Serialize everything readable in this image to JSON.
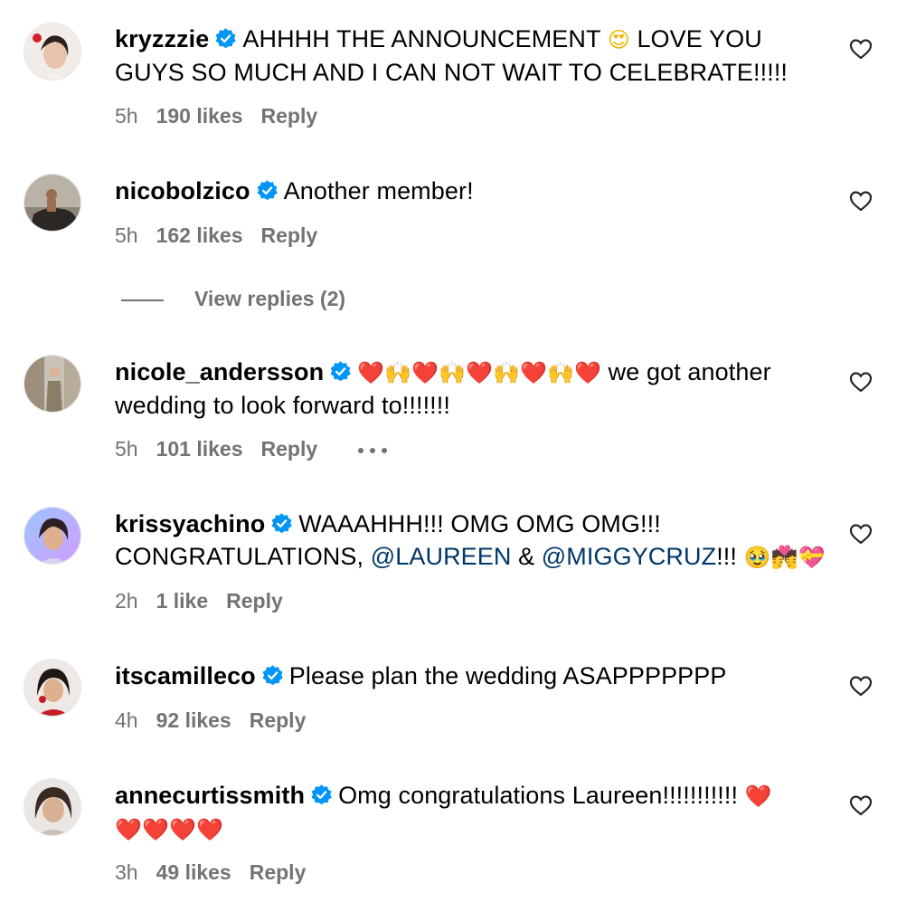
{
  "colors": {
    "text": "#000000",
    "secondary": "#737373",
    "verified_blue": "#0095f6",
    "mention": "#00376b",
    "heart_red": "#e0192c"
  },
  "icons": {
    "verified": "verified-badge-icon",
    "like": "heart-outline-icon",
    "more": "more-dots-icon"
  },
  "comments": [
    {
      "username": "kryzzzie",
      "text_parts": [
        "AHHHH THE ANNOUNCEMENT ",
        "😍",
        " LOVE YOU GUYS SO MUCH AND I CAN NOT WAIT TO CELEBRATE!!!!!"
      ],
      "time": "5h",
      "likes": "190 likes",
      "reply": "Reply"
    },
    {
      "username": "nicobolzico",
      "text": "Another member!",
      "time": "5h",
      "likes": "162 likes",
      "reply": "Reply"
    },
    {
      "username": "nicole_andersson",
      "emoji_run": [
        "❤️",
        "🙌",
        "❤️",
        "🙌",
        "❤️",
        "🙌",
        "❤️",
        "🙌",
        "❤️"
      ],
      "text": " we got another wedding to look forward to!!!!!!!",
      "time": "5h",
      "likes": "101 likes",
      "reply": "Reply"
    },
    {
      "username": "krissyachino",
      "text_a": "WAAAHHH!!! OMG OMG OMG!!! CONGRATULATIONS, ",
      "mention_1": "@LAUREEN",
      "text_b": " & ",
      "mention_2": "@MIGGYCRUZ",
      "text_c": "!!! ",
      "emoji_end": [
        "🥹",
        "💏",
        "💝"
      ],
      "time": "2h",
      "likes": "1 like",
      "reply": "Reply"
    },
    {
      "username": "itscamilleco",
      "text": "Please plan the wedding ASAPPPPPPP",
      "time": "4h",
      "likes": "92 likes",
      "reply": "Reply"
    },
    {
      "username": "annecurtissmith",
      "text": "Omg congratulations Laureen!!!!!!!!!!! ",
      "hearts": [
        "❤️",
        "❤️",
        "❤️",
        "❤️",
        "❤️"
      ],
      "time": "3h",
      "likes": "49 likes",
      "reply": "Reply"
    }
  ],
  "view_replies": "View replies (2)"
}
